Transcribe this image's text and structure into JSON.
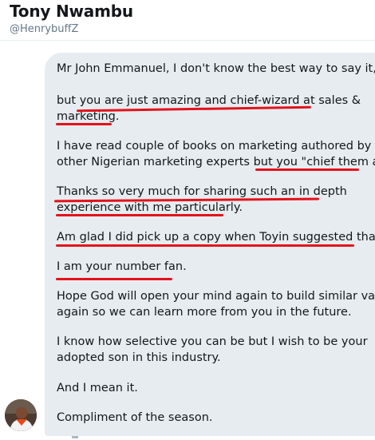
{
  "profile": {
    "display_name": "Tony Nwambu",
    "handle": "@HenrybuffZ"
  },
  "message": {
    "lines": [
      "Mr John Emmanuel, I don't know the best way to say it,",
      "but you are just amazing and chief-wizard at sales &",
      "marketing.",
      "I have read couple of books on marketing authored by",
      "other Nigerian marketing experts but you \"chief them all\"",
      "Thanks so very much for sharing such an in depth",
      "experience with me particularly.",
      "Am glad I did pick up a copy when Toyin suggested that.",
      "I am your number fan.",
      "Hope God will open your mind again to build similar value",
      "again so we can learn more from you in the future.",
      "I know how selective you can be but I wish to be your",
      "adopted son in this industry.",
      "And I mean it.",
      "Compliment of the season."
    ]
  },
  "colors": {
    "bubble_bg": "#e6ecf0",
    "underline": "#e3121b",
    "handle_text": "#657786"
  },
  "icons": {
    "avatar": "user-avatar-photo"
  }
}
